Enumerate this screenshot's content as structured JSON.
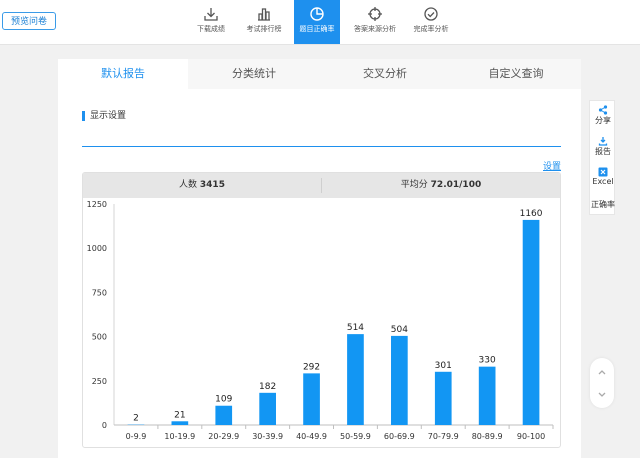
{
  "header": {
    "preview_button": "预览问卷",
    "nav": [
      {
        "label": "下载成绩",
        "icon": "download-icon"
      },
      {
        "label": "考试排行榜",
        "icon": "bar-ranking-icon"
      },
      {
        "label": "题目正确率",
        "icon": "pie-chart-icon"
      },
      {
        "label": "答案来源分析",
        "icon": "crosshair-icon"
      },
      {
        "label": "完成率分析",
        "icon": "check-circle-icon"
      }
    ],
    "active_nav_index": 2
  },
  "tabs": [
    "默认报告",
    "分类统计",
    "交叉分析",
    "自定义查询"
  ],
  "active_tab_index": 0,
  "section_title": "显示设置",
  "settings_link": "设置",
  "stats": {
    "count_label": "人数",
    "count_value": "3415",
    "avg_label": "平均分",
    "avg_value": "72.01/100"
  },
  "sidebar": [
    {
      "label": "分享",
      "icon": "share-icon"
    },
    {
      "label": "报告",
      "icon": "download-report-icon"
    },
    {
      "label": "Excel",
      "icon": "excel-icon"
    },
    {
      "label": "正确率",
      "icon": ""
    }
  ],
  "colors": {
    "accent": "#1e90ee",
    "bar": "#1296f3"
  },
  "chart_data": {
    "type": "bar",
    "categories": [
      "0-9.9",
      "10-19.9",
      "20-29.9",
      "30-39.9",
      "40-49.9",
      "50-59.9",
      "60-69.9",
      "70-79.9",
      "80-89.9",
      "90-100"
    ],
    "values": [
      2,
      21,
      109,
      182,
      292,
      514,
      504,
      301,
      330,
      1160
    ],
    "ylim": [
      0,
      1250
    ],
    "yticks": [
      0,
      250,
      500,
      750,
      1000,
      1250
    ],
    "grid": false
  }
}
